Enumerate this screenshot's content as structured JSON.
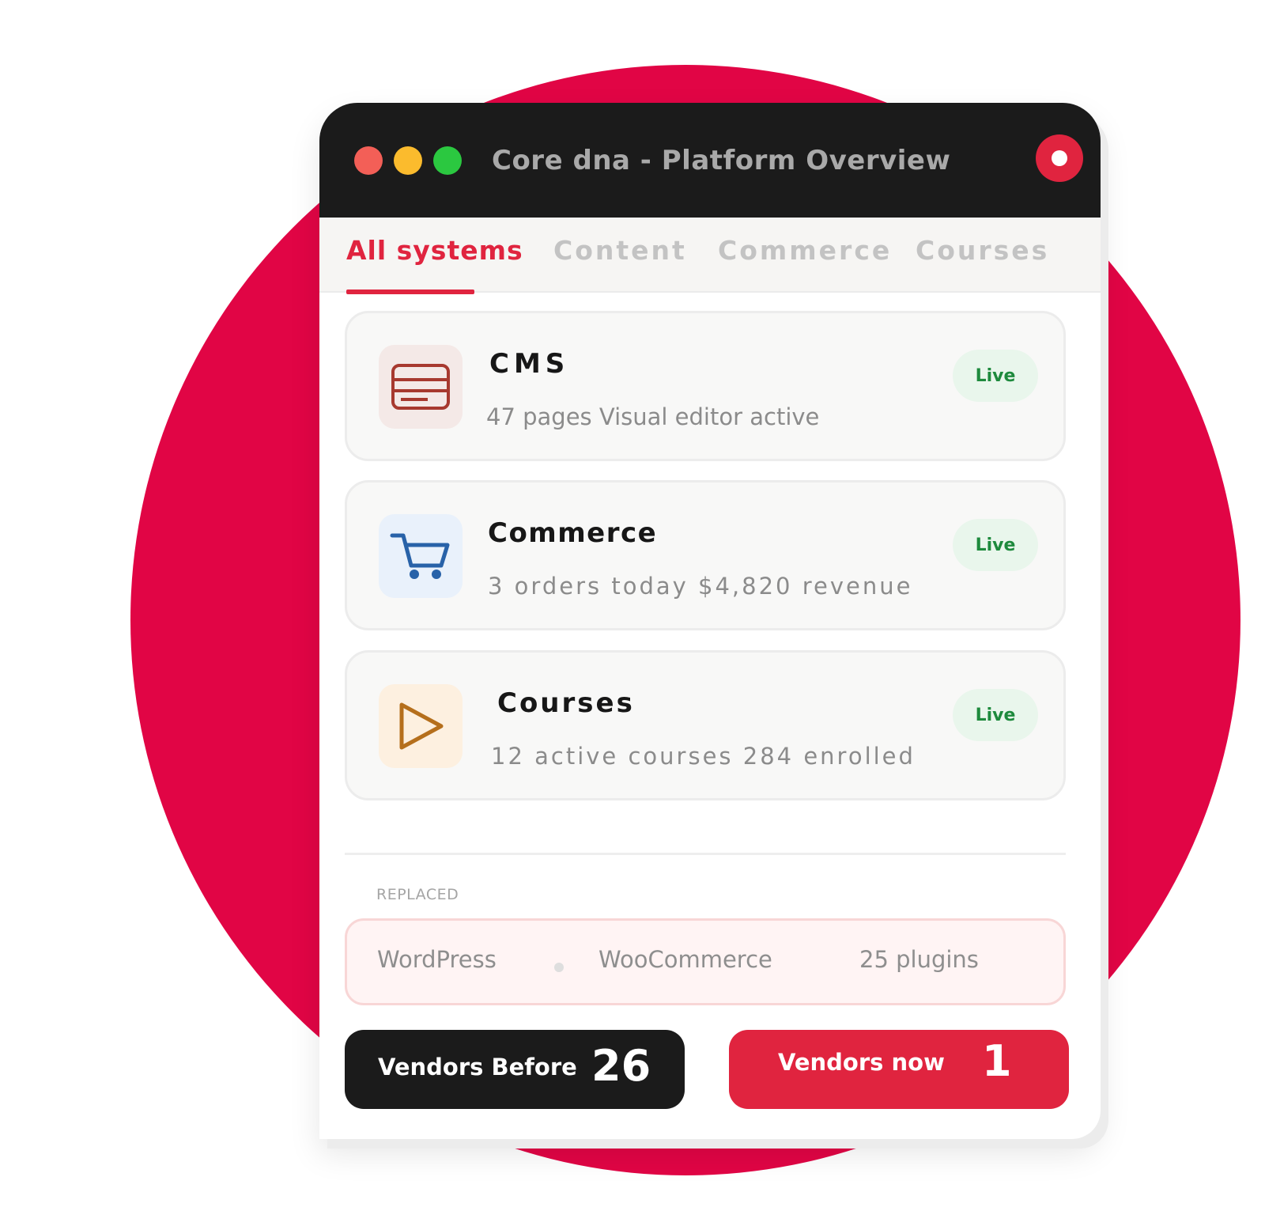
{
  "window": {
    "title": "Core dna - Platform Overview"
  },
  "tabs": [
    {
      "label": "All systems",
      "active": true
    },
    {
      "label": "Content",
      "active": false
    },
    {
      "label": "Commerce",
      "active": false
    },
    {
      "label": "Courses",
      "active": false
    }
  ],
  "cards": [
    {
      "title": "CMS",
      "subtitle": "47 pages Visual editor active",
      "status": "Live",
      "icon": "card-icon"
    },
    {
      "title": "Commerce",
      "subtitle": "3 orders today $4,820 revenue",
      "status": "Live",
      "icon": "cart-icon"
    },
    {
      "title": "Courses",
      "subtitle": "12 active courses 284 enrolled",
      "status": "Live",
      "icon": "play-icon"
    }
  ],
  "replaced": {
    "label": "REPLACED",
    "items": [
      "WordPress",
      "WooCommerce",
      "25 plugins"
    ]
  },
  "vendors": {
    "before_label": "Vendors Before",
    "before_value": "26",
    "now_label": "Vendors now",
    "now_value": "1"
  },
  "colors": {
    "accent": "#e0243f",
    "background_circle": "#e10545",
    "titlebar": "#1b1b1b",
    "live_badge_text": "#1e8a3d"
  }
}
